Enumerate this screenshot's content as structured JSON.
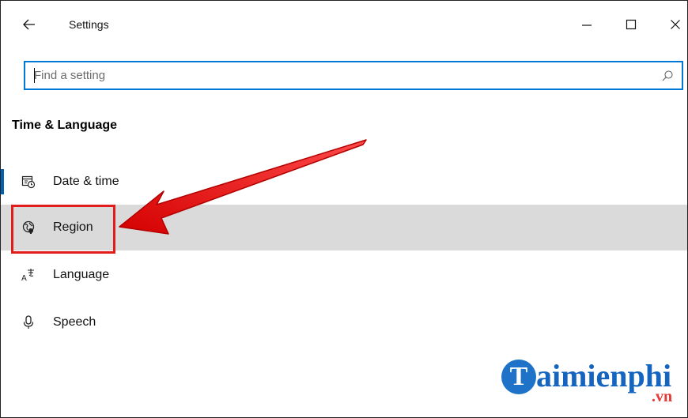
{
  "window": {
    "title": "Settings",
    "back_icon": "arrow-left-icon",
    "minimize_icon": "minimize-icon",
    "maximize_icon": "maximize-icon",
    "close_icon": "close-icon"
  },
  "search": {
    "placeholder": "Find a setting",
    "value": "",
    "icon": "search-icon",
    "border_color": "#0078d7"
  },
  "section": {
    "title": "Time & Language"
  },
  "nav": {
    "items": [
      {
        "label": "Date & time",
        "icon": "calendar-clock-icon",
        "active": true
      },
      {
        "label": "Region",
        "icon": "globe-region-icon",
        "hovered": true
      },
      {
        "label": "Language",
        "icon": "language-icon"
      },
      {
        "label": "Speech",
        "icon": "microphone-icon"
      }
    ],
    "active_indicator_color": "#0063b1",
    "hover_background": "#dadada"
  },
  "annotation": {
    "highlight_color": "#e21b1b",
    "target": "Region"
  },
  "watermark": {
    "initial": "T",
    "text": "aimienphi",
    "suffix": ".vn",
    "brand_color": "#1565c0",
    "suffix_color": "#e53935"
  }
}
